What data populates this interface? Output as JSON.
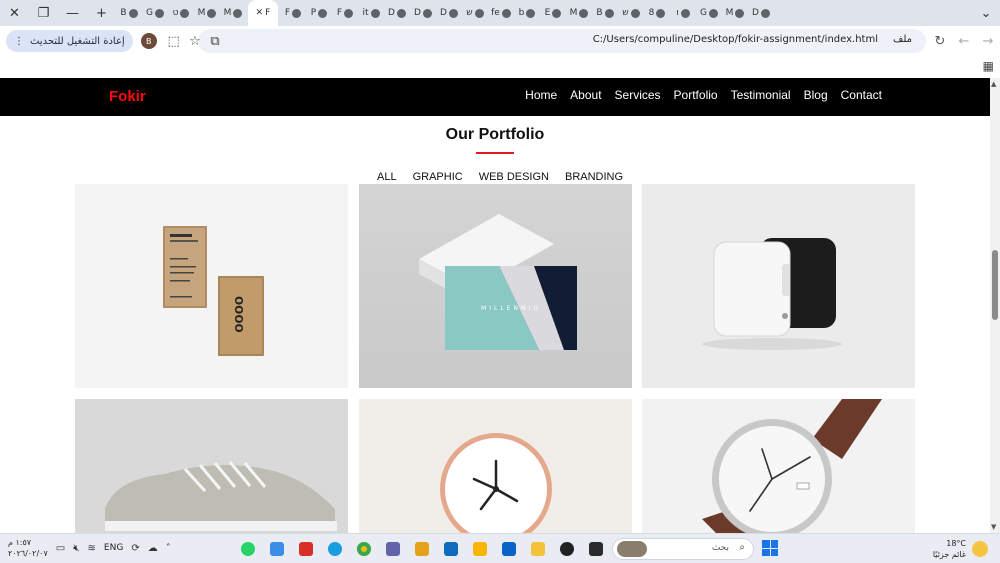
{
  "browser": {
    "tab_labels": [
      "B",
      "G",
      "ט",
      "M",
      "M",
      "F",
      "P",
      "F",
      "it",
      "D",
      "D",
      "D",
      "ש",
      "fe",
      "b",
      "E",
      "M",
      "B",
      "ש",
      "8",
      "ו",
      "G",
      "M",
      "D"
    ],
    "active_tab_label": "F",
    "update_button_label": "إعادة التشغيل للتحديث",
    "profile_initial": "B",
    "url": "C:/Users/compuline/Desktop/fokir-assignment/index.html",
    "file_label": "ملف"
  },
  "site": {
    "logo": "Fokir",
    "nav": [
      "Home",
      "About",
      "Services",
      "Portfolio",
      "Testimonial",
      "Blog",
      "Contact"
    ],
    "section_title": "Our Portfolio",
    "filters": [
      "ALL",
      "GRAPHIC",
      "WEB DESIGN",
      "BRANDING"
    ],
    "colors": {
      "header_bg": "#000000",
      "logo": "#ff0a0a",
      "accent": "#e31b23"
    }
  },
  "portfolio_items": [
    {
      "name": "kraft-business-cards",
      "card_text": "oooo"
    },
    {
      "name": "millennio-business-cards",
      "card_text": "MILLENNIO"
    },
    {
      "name": "white-black-device",
      "card_text": ""
    },
    {
      "name": "grey-sneaker",
      "card_text": ""
    },
    {
      "name": "rose-gold-clock",
      "card_text": ""
    },
    {
      "name": "brown-strap-watch",
      "card_text": ""
    }
  ],
  "taskbar": {
    "time": "١:٥٧ م",
    "date": "٢٠٢٦/٠٢/٠٧",
    "language": "ENG",
    "search_placeholder": "بحث",
    "temperature": "18°C",
    "weather": "غائم جزئيًا"
  }
}
